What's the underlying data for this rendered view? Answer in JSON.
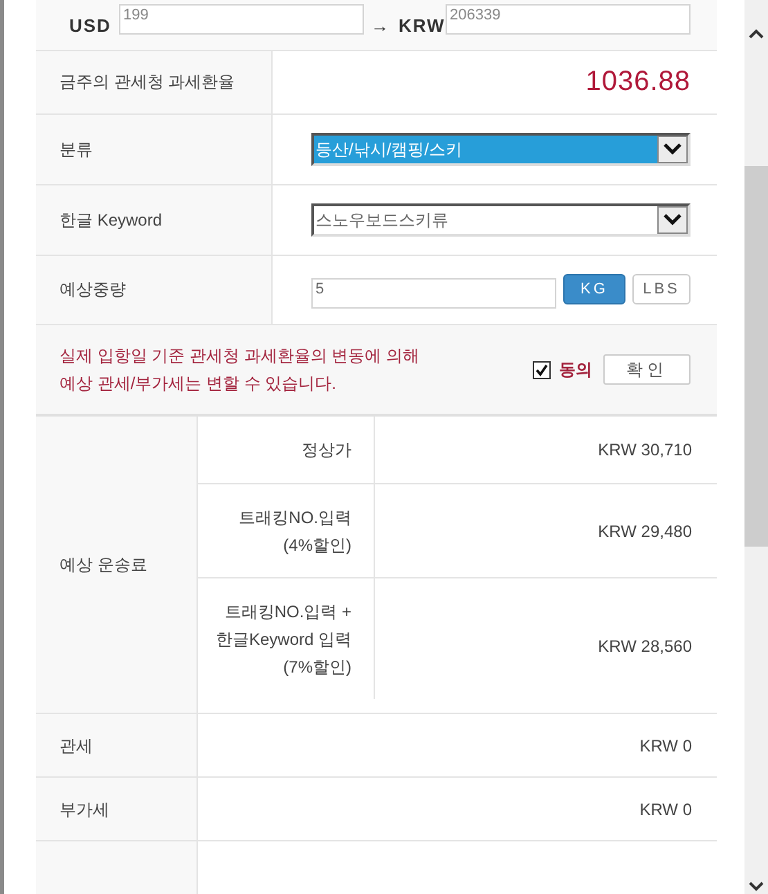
{
  "converter": {
    "from_currency": "USD",
    "from_value": "199",
    "arrow": "→",
    "to_currency": "KRW",
    "to_value": "206339"
  },
  "exchange_rate": {
    "label": "금주의 관세청 과세환율",
    "value": "1036.88"
  },
  "category": {
    "label": "분류",
    "value": "등산/낚시/캠핑/스키",
    "highlighted": true
  },
  "keyword": {
    "label": "한글 Keyword",
    "value": "스노우보드스키류",
    "highlighted": false
  },
  "weight": {
    "label": "예상중량",
    "value": "5",
    "units": [
      {
        "label": "KG",
        "selected": true
      },
      {
        "label": "LBS",
        "selected": false
      }
    ]
  },
  "notice": {
    "lines": [
      "실제 입항일 기준 관세청 과세환율의 변동에 의해",
      "예상 관세/부가세는 변할 수 있습니다."
    ],
    "agree": {
      "label": "동의",
      "checked": true
    },
    "confirm_button": "확인"
  },
  "shipping": {
    "label": "예상 운송료",
    "rows": [
      {
        "lines": [
          "정상가"
        ],
        "amount": "KRW 30,710"
      },
      {
        "lines": [
          "트래킹NO.입력",
          "(4%할인)"
        ],
        "amount": "KRW 29,480"
      },
      {
        "lines": [
          "트래킹NO.입력 +",
          "한글Keyword 입력",
          "(7%할인)"
        ],
        "amount": "KRW 28,560"
      }
    ]
  },
  "charges": [
    {
      "label": "관세",
      "amount": "KRW 0"
    },
    {
      "label": "부가세",
      "amount": "KRW 0"
    }
  ]
}
